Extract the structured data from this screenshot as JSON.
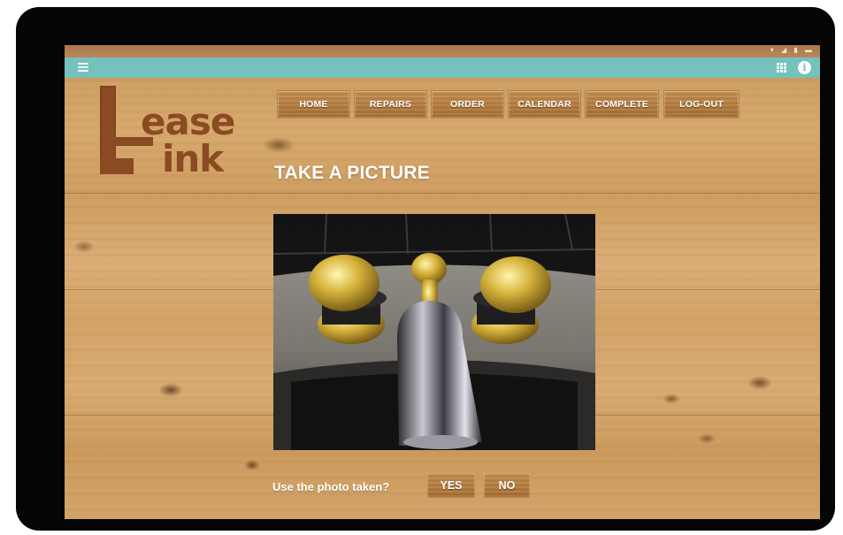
{
  "logo": {
    "line1": "ease",
    "line2": "ink"
  },
  "nav": [
    {
      "label": "HOME"
    },
    {
      "label": "REPAIRS"
    },
    {
      "label": "ORDER"
    },
    {
      "label": "CALENDAR"
    },
    {
      "label": "COMPLETE"
    },
    {
      "label": "LOG-OUT"
    }
  ],
  "page": {
    "title": "TAKE A PICTURE"
  },
  "confirm": {
    "question": "Use the photo taken?",
    "yes": "YES",
    "no": "NO"
  },
  "icons": {
    "menu": "hamburger-menu-icon",
    "apps": "apps-grid-icon",
    "info": "info-icon"
  },
  "colors": {
    "appbar": "#74c1bd",
    "brand": "#8a4a22",
    "button": "#b57d41",
    "frame": "#050505"
  }
}
